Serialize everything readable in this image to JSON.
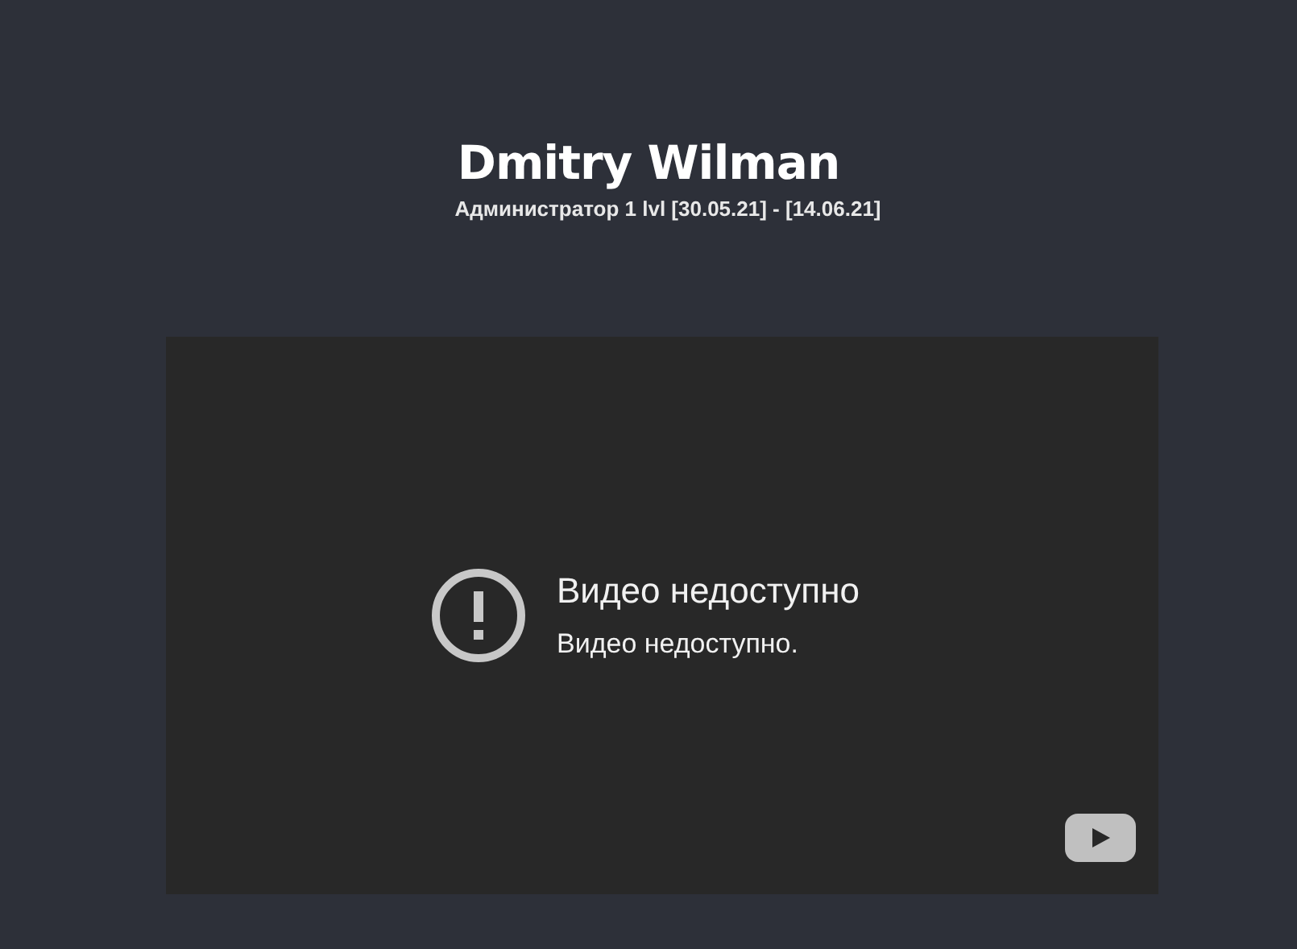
{
  "header": {
    "name": "Dmitry Wilman",
    "subtitle": "Администратор 1 lvl [30.05.21] - [14.06.21]"
  },
  "video": {
    "title": "Видео недоступно",
    "message": "Видео недоступно."
  }
}
